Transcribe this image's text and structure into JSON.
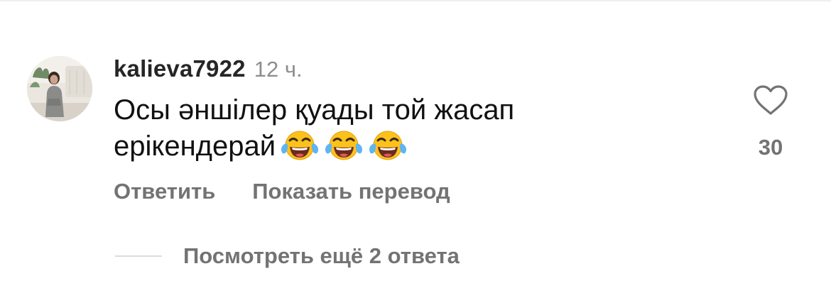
{
  "comment": {
    "username": "kalieva7922",
    "timestamp": "12 ч.",
    "text_line_1": "Осы әншілер қуады той жасап",
    "text_line_2": "ерікендерай",
    "emojis": [
      "face-with-tears-of-joy",
      "face-with-tears-of-joy",
      "face-with-tears-of-joy"
    ],
    "avatar_icon": "user-avatar-photo"
  },
  "like": {
    "icon": "heart-outline-icon",
    "count": "30"
  },
  "actions": {
    "reply_label": "Ответить",
    "translate_label": "Показать перевод"
  },
  "replies": {
    "label": "Посмотреть ещё 2 ответа"
  }
}
